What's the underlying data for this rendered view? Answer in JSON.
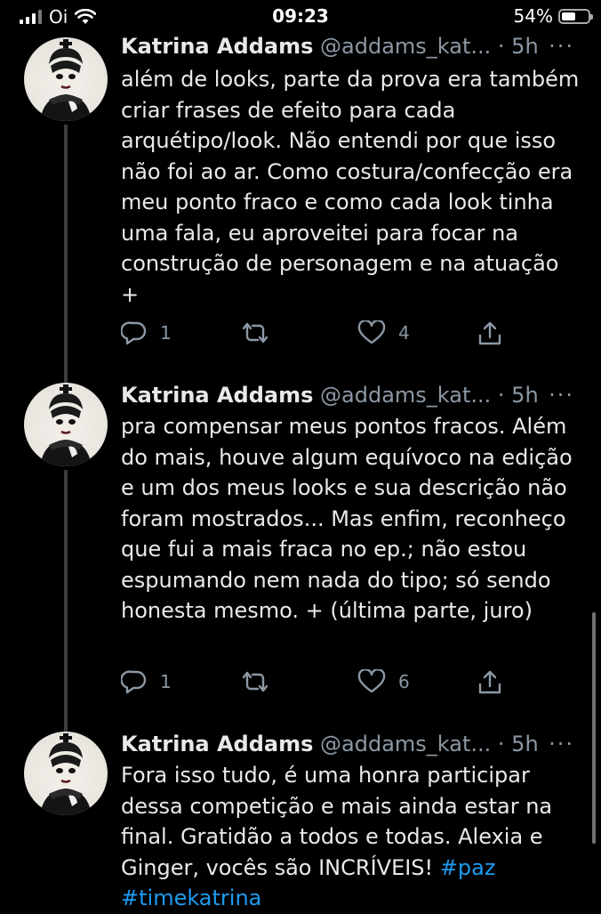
{
  "status_bar": {
    "carrier": "Oi",
    "time": "09:23",
    "battery": "54%",
    "battery_level": 0.54
  },
  "tweets": [
    {
      "name": "Katrina Addams",
      "handle": "@addams_kat...",
      "time": "· 5h",
      "more": "···",
      "text": "além de looks, parte da prova era também criar frases de efeito para cada arquétipo/look. Não entendi por que isso não foi ao ar. Como costura/confecção era meu ponto fraco e como cada look tinha uma fala, eu aproveitei para focar na construção de personagem e na atuação +",
      "replies": "1",
      "retweets": "",
      "likes": "4"
    },
    {
      "name": "Katrina Addams",
      "handle": "@addams_kat...",
      "time": "· 5h",
      "more": "···",
      "text": "pra compensar meus pontos fracos. Além do mais, houve algum equívoco na edição e um dos meus looks e sua descrição não foram mostrados... Mas enfim, reconheço que fui a mais fraca no ep.; não estou espumando nem nada do tipo; só sendo honesta mesmo. + (última parte, juro)",
      "replies": "1",
      "retweets": "",
      "likes": "6"
    },
    {
      "name": "Katrina Addams",
      "handle": "@addams_kat...",
      "time": "· 5h",
      "more": "···",
      "text": "Fora isso tudo, é uma honra participar dessa competição e mais ainda estar na final. Gratidão a todos e todas. Alexia e Ginger, vocês são INCRÍVEIS!",
      "hashtags": [
        "#paz",
        "#timekatrina"
      ]
    }
  ],
  "icons": {
    "reply": "reply-icon",
    "retweet": "retweet-icon",
    "like": "heart-icon",
    "share": "share-icon",
    "more": "more-icon"
  }
}
